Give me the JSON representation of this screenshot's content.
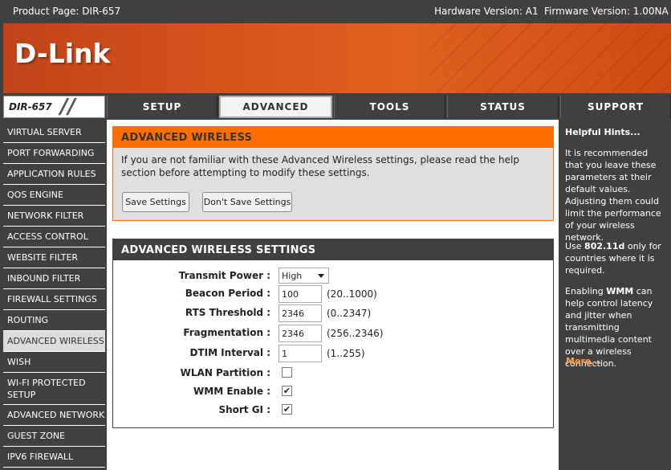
{
  "topbar": {
    "product": "Product Page: DIR-657",
    "hardware": "Hardware Version: A1",
    "firmware": "Firmware Version: 1.00NA"
  },
  "banner": {
    "logo": "D-Link"
  },
  "model": {
    "name": "DIR-657",
    "slashes": "//"
  },
  "nav": {
    "tabs": [
      "SETUP",
      "ADVANCED",
      "TOOLS",
      "STATUS",
      "SUPPORT"
    ],
    "active": "ADVANCED"
  },
  "sidebar": {
    "items": [
      "VIRTUAL SERVER",
      "PORT FORWARDING",
      "APPLICATION RULES",
      "QOS ENGINE",
      "NETWORK FILTER",
      "ACCESS CONTROL",
      "WEBSITE FILTER",
      "INBOUND FILTER",
      "FIREWALL SETTINGS",
      "ROUTING",
      "ADVANCED WIRELESS",
      "WISH",
      "WI-FI PROTECTED SETUP",
      "ADVANCED NETWORK",
      "GUEST ZONE",
      "IPV6 FIREWALL"
    ],
    "active": "ADVANCED WIRELESS"
  },
  "advanced_panel": {
    "title": "ADVANCED WIRELESS",
    "description": "If you are not familiar with these Advanced Wireless settings, please read the help section before attempting to modify these settings.",
    "save_label": "Save Settings",
    "dont_save_label": "Don't Save Settings"
  },
  "settings_panel": {
    "title": "ADVANCED WIRELESS SETTINGS",
    "transmit_power": {
      "label": "Transmit Power :",
      "value": "High"
    },
    "beacon_period": {
      "label": "Beacon Period :",
      "value": "100",
      "range": "(20..1000)"
    },
    "rts_threshold": {
      "label": "RTS Threshold :",
      "value": "2346",
      "range": "(0..2347)"
    },
    "fragmentation": {
      "label": "Fragmentation :",
      "value": "2346",
      "range": "(256..2346)"
    },
    "dtim_interval": {
      "label": "DTIM Interval :",
      "value": "1",
      "range": "(1..255)"
    },
    "wlan_partition": {
      "label": "WLAN Partition :",
      "checked": false
    },
    "wmm_enable": {
      "label": "WMM Enable :",
      "checked": true
    },
    "short_gi": {
      "label": "Short GI :",
      "checked": true
    }
  },
  "hints": {
    "title": "Helpful Hints...",
    "p1": "It is recommended that you leave these parameters at their default values. Adjusting them could limit the performance of your wireless network.",
    "p2_prefix": "Use ",
    "p2_bold": "802.11d",
    "p2_suffix": " only for countries where it is required.",
    "p3_prefix": "Enabling ",
    "p3_bold": "WMM",
    "p3_suffix": " can help control latency and jitter when transmitting multimedia content over a wireless connection.",
    "more": "More..."
  },
  "colors": {
    "accent_orange": "#ff6f00",
    "dark_gray": "#404040",
    "banner_orange": "#d9541c"
  }
}
